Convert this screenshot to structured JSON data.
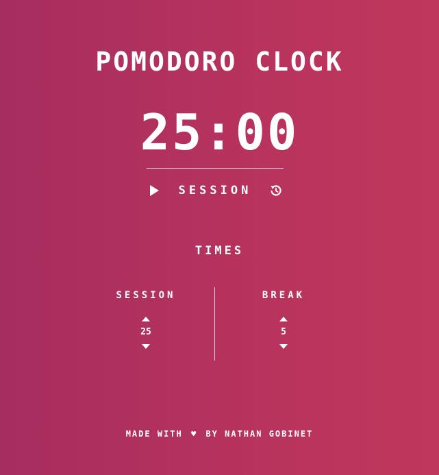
{
  "app": {
    "title": "POMODORO CLOCK"
  },
  "timer": {
    "display": "25:00",
    "mode": "SESSION"
  },
  "settings": {
    "heading": "TIMES",
    "session": {
      "label": "SESSION",
      "value": "25"
    },
    "break": {
      "label": "BREAK",
      "value": "5"
    }
  },
  "footer": {
    "prefix": "MADE WITH",
    "heart": "♥",
    "by": "BY",
    "author": "NATHAN GOBINET"
  },
  "icons": {
    "play": "play-icon",
    "reset": "reset-icon",
    "up": "caret-up-icon",
    "down": "caret-down-icon"
  },
  "colors": {
    "gradient_start": "#a62d5f",
    "gradient_end": "#c0375c",
    "text": "#ffffff"
  }
}
